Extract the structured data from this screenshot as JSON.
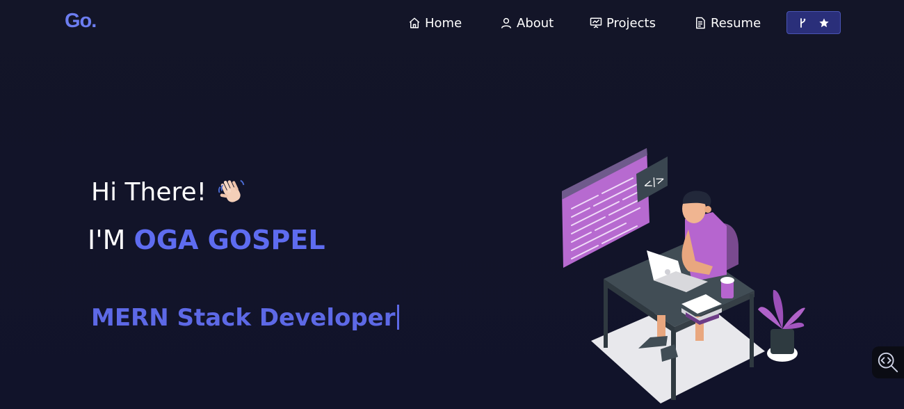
{
  "brand": {
    "logo": "Go."
  },
  "nav": {
    "home": "Home",
    "about": "About",
    "projects": "Projects",
    "resume": "Resume"
  },
  "hero": {
    "greeting": "Hi There!",
    "intro_prefix": "I'M",
    "name": "OGA GOSPEL",
    "role": "MERN Stack Developer"
  },
  "colors": {
    "background": "#121426",
    "accent": "#5e6cf0",
    "button_bg": "#2a2f7a"
  },
  "icons": {
    "home": "home-icon",
    "about": "user-icon",
    "projects": "presentation-icon",
    "resume": "document-icon",
    "fork": "git-fork-icon",
    "star": "star-icon",
    "wave": "waving-hand-icon",
    "widget": "code-search-icon"
  }
}
